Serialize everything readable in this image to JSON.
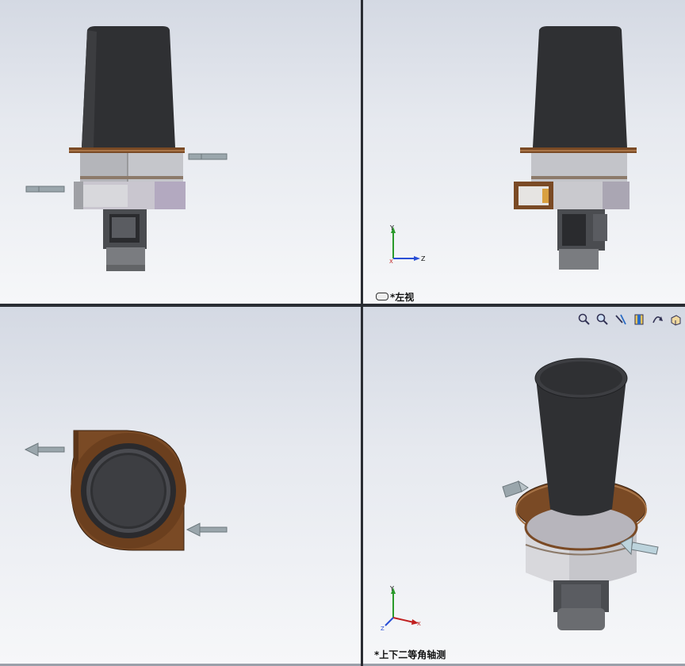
{
  "viewports": {
    "top_right": {
      "label": "*左视"
    },
    "bottom_right": {
      "label": "*上下二等角轴测"
    }
  },
  "triad": {
    "y": "Y",
    "z": "Z",
    "x": "X"
  },
  "toolbar": {
    "icons": [
      "zoom-to-fit-icon",
      "zoom-to-area-icon",
      "previous-view-icon",
      "section-view-icon",
      "view-orientation-icon",
      "display-style-icon"
    ]
  },
  "colors": {
    "viewport_top": "#d4d9e3",
    "viewport_bottom": "#f6f7f9",
    "hopper": "#2f3033",
    "flange": "#7a4a25",
    "housing": "#c8c8cc",
    "motor": "#6a6c70",
    "arrow": "#9aa6ac",
    "divider": "#2a2d33"
  }
}
